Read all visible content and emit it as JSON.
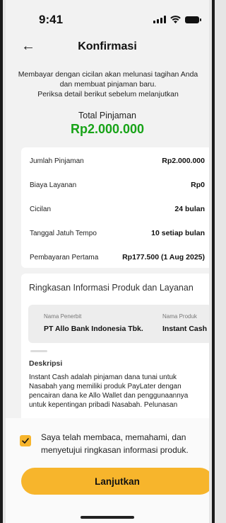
{
  "status_bar": {
    "time": "9:41",
    "icons": [
      "signal-icon",
      "wifi-icon",
      "battery-icon"
    ]
  },
  "header": {
    "back_icon": "arrow-left-icon",
    "title": "Konfirmasi"
  },
  "intro": {
    "line1": "Membayar dengan cicilan akan melunasi tagihan Anda",
    "line2": "dan membuat pinjaman baru.",
    "line3": "Periksa detail berikut sebelum melanjutkan"
  },
  "total": {
    "label": "Total Pinjaman",
    "value": "Rp2.000.000"
  },
  "details": [
    {
      "label": "Jumlah Pinjaman",
      "value": "Rp2.000.000"
    },
    {
      "label": "Biaya Layanan",
      "value": "Rp0"
    },
    {
      "label": "Cicilan",
      "value": "24 bulan"
    },
    {
      "label": "Tanggal Jatuh Tempo",
      "value": "10 setiap bulan"
    },
    {
      "label": "Pembayaran Pertama",
      "value": "Rp177.500 (1 Aug 2025)"
    }
  ],
  "summary": {
    "title": "Ringkasan Informasi Produk dan Layanan",
    "issuer_label": "Nama Penerbit",
    "issuer_value": "PT Allo Bank Indonesia Tbk.",
    "product_label": "Nama Produk",
    "product_value": "Instant Cash",
    "desc_title": "Deskripsi",
    "desc_text": "Instant Cash adalah pinjaman dana tunai untuk Nasabah yang memiliki produk PayLater dengan pencairan dana ke Allo Wallet dan penggunaannya untuk kepentingan pribadi Nasabah. Pelunasan"
  },
  "agreement": {
    "checked": true,
    "text": "Saya telah membaca, memahami, dan menyetujui ringkasan informasi produk."
  },
  "cta": {
    "label": "Lanjutkan"
  },
  "colors": {
    "accent": "#f7b52c",
    "amount_green": "#17a317",
    "background": "#f2f2f2",
    "card": "#ffffff"
  }
}
